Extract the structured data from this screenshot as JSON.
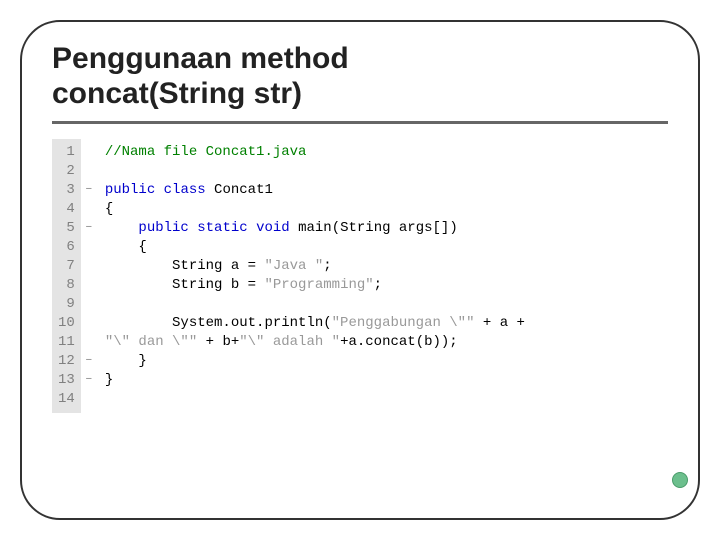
{
  "title_line1": "Penggunaan method",
  "title_line2": "concat(String str)",
  "line_numbers": [
    "1",
    "2",
    "3",
    "4",
    "5",
    "6",
    "7",
    "8",
    "9",
    "10",
    "11",
    "12",
    "13",
    "14"
  ],
  "fold_marks": [
    "",
    "",
    "−",
    "",
    "−",
    "",
    "",
    "",
    "",
    "",
    "",
    "−",
    "−",
    ""
  ],
  "code": {
    "l1_comment": "//Nama file Concat1.java",
    "l3_kw1": "public",
    "l3_kw2": "class",
    "l3_name": " Concat1",
    "l4": "{",
    "l5_kw1": "public",
    "l5_kw2": "static",
    "l5_kw3": "void",
    "l5_rest": " main(String args[])",
    "l6": "    {",
    "l7_pre": "        String a = ",
    "l7_str": "\"Java \"",
    "l7_post": ";",
    "l8_pre": "        String b = ",
    "l8_str": "\"Programming\"",
    "l8_post": ";",
    "l10_pre": "        System.out.println(",
    "l10_str": "\"Penggabungan \\\"\"",
    "l10_post": " + a +",
    "l11_s1": "\"\\\" dan \\\"\"",
    "l11_m1": " + b+",
    "l11_s2": "\"\\\" adalah \"",
    "l11_m2": "+a.concat(b));",
    "l12": "    }",
    "l13": "}"
  }
}
